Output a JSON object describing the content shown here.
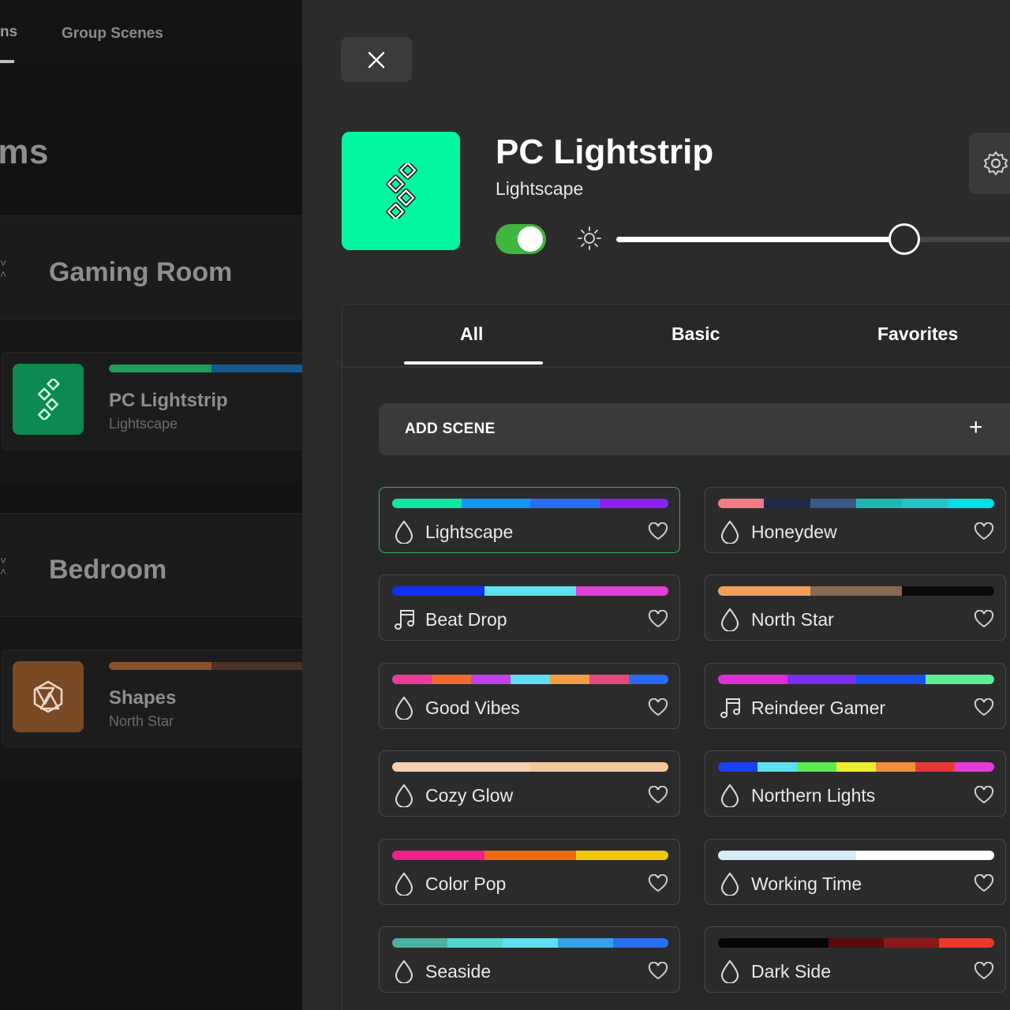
{
  "left": {
    "nav_tab_partial": "ns",
    "nav_tab_group": "Group Scenes",
    "title_partial": "oms",
    "rooms": [
      {
        "name": "Gaming Room",
        "device": {
          "name": "PC Lightstrip",
          "scene": "Lightscape",
          "icon": "lightstrip-icon",
          "icon_bg": "#0c8a52",
          "bar_colors": [
            "#1e9e5e",
            "#1e9e5e",
            "#135a93",
            "#135a93"
          ]
        }
      },
      {
        "name": "Bedroom",
        "device": {
          "name": "Shapes",
          "scene": "North Star",
          "icon": "shapes-icon",
          "icon_bg": "#7a4a24",
          "bar_colors": [
            "#8a522c",
            "#8a522c",
            "#4a3326",
            "#4a3326"
          ]
        }
      }
    ]
  },
  "panel": {
    "device_name": "PC Lightstrip",
    "scene_name": "Lightscape",
    "device_icon_color": "#03f7a0",
    "power_on": true,
    "brightness": 0.7,
    "tabs": [
      {
        "label": "All",
        "active": true
      },
      {
        "label": "Basic",
        "active": false
      },
      {
        "label": "Favorites",
        "active": false
      }
    ],
    "add_scene_label": "ADD SCENE",
    "add_scene_plus": "+",
    "scenes": [
      {
        "name": "Lightscape",
        "type": "drop",
        "selected": true,
        "colors": [
          "#0ee8a2",
          "#1496f0",
          "#2a6ef2",
          "#8a22f0"
        ]
      },
      {
        "name": "Honeydew",
        "type": "drop",
        "selected": false,
        "colors": [
          "#f37b82",
          "#1f2a4a",
          "#3b5a85",
          "#1fb5b5",
          "#25c4c4",
          "#00e0e8"
        ]
      },
      {
        "name": "Beat Drop",
        "type": "music",
        "selected": false,
        "colors": [
          "#1030f0",
          "#5ee0f2",
          "#e040d8"
        ]
      },
      {
        "name": "North Star",
        "type": "drop",
        "selected": false,
        "colors": [
          "#f0a05a",
          "#8a6a52",
          "#0a0a0a"
        ]
      },
      {
        "name": "Good Vibes",
        "type": "drop",
        "selected": false,
        "colors": [
          "#ee3a9a",
          "#f06a30",
          "#c040ec",
          "#5ee0f2",
          "#f0a040",
          "#e24a7a",
          "#2a6af2"
        ]
      },
      {
        "name": "Reindeer Gamer",
        "type": "music",
        "selected": false,
        "colors": [
          "#e02ed6",
          "#7a2ef0",
          "#1a50f0",
          "#60ec96"
        ]
      },
      {
        "name": "Cozy Glow",
        "type": "drop",
        "selected": false,
        "colors": [
          "#f6d0b0",
          "#f2c89a"
        ]
      },
      {
        "name": "Northern Lights",
        "type": "drop",
        "selected": false,
        "colors": [
          "#1a40f0",
          "#5ee0f2",
          "#5eea52",
          "#eaee32",
          "#f0903a",
          "#e63a3a",
          "#e03ed6"
        ]
      },
      {
        "name": "Color Pop",
        "type": "drop",
        "selected": false,
        "colors": [
          "#f0208a",
          "#f06a10",
          "#f0c810"
        ]
      },
      {
        "name": "Working Time",
        "type": "drop",
        "selected": false,
        "colors": [
          "#d6ecf8",
          "#ffffff"
        ]
      },
      {
        "name": "Seaside",
        "type": "drop",
        "selected": false,
        "colors": [
          "#4eb0a0",
          "#52d8d0",
          "#5ee0f2",
          "#36a0e6",
          "#2a6ef0"
        ]
      },
      {
        "name": "Dark Side",
        "type": "drop",
        "selected": false,
        "colors": [
          "#050505",
          "#050505",
          "#5a0a0a",
          "#8a1a1a",
          "#e63a2a"
        ]
      }
    ]
  }
}
